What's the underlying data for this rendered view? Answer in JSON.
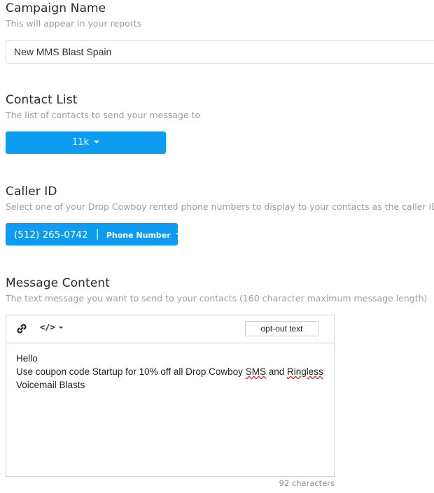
{
  "campaign_name": {
    "title": "Campaign Name",
    "subtitle": "This will appear in your reports",
    "value": "New MMS Blast Spain"
  },
  "contact_list": {
    "title": "Contact List",
    "subtitle": "The list of contacts to send your message to",
    "button_label": "11k"
  },
  "caller_id": {
    "title": "Caller ID",
    "subtitle": "Select one of your Drop Cowboy rented phone numbers to display to your contacts as the caller ID",
    "number": "(512) 265-0742",
    "separator": "|",
    "type_label": "Phone Number"
  },
  "message_content": {
    "title": "Message Content",
    "subtitle": "The text message you want to send to your contacts (160 character maximum message length)",
    "toolbar": {
      "link_icon": "link-icon",
      "code_icon": "code-icon",
      "optout_label": "opt-out text"
    },
    "message": {
      "line1": "Hello",
      "line2_prefix": "Use coupon code Startup for 10% off all Drop Cowboy ",
      "line2_sms": "SMS",
      "line2_and": " and ",
      "line2_ringless": "Ringless",
      "line3": "Voicemail Blasts"
    },
    "char_count": "92 characters"
  },
  "colors": {
    "accent": "#0d9cf2",
    "subtitle_gray": "#9a9ea4"
  }
}
